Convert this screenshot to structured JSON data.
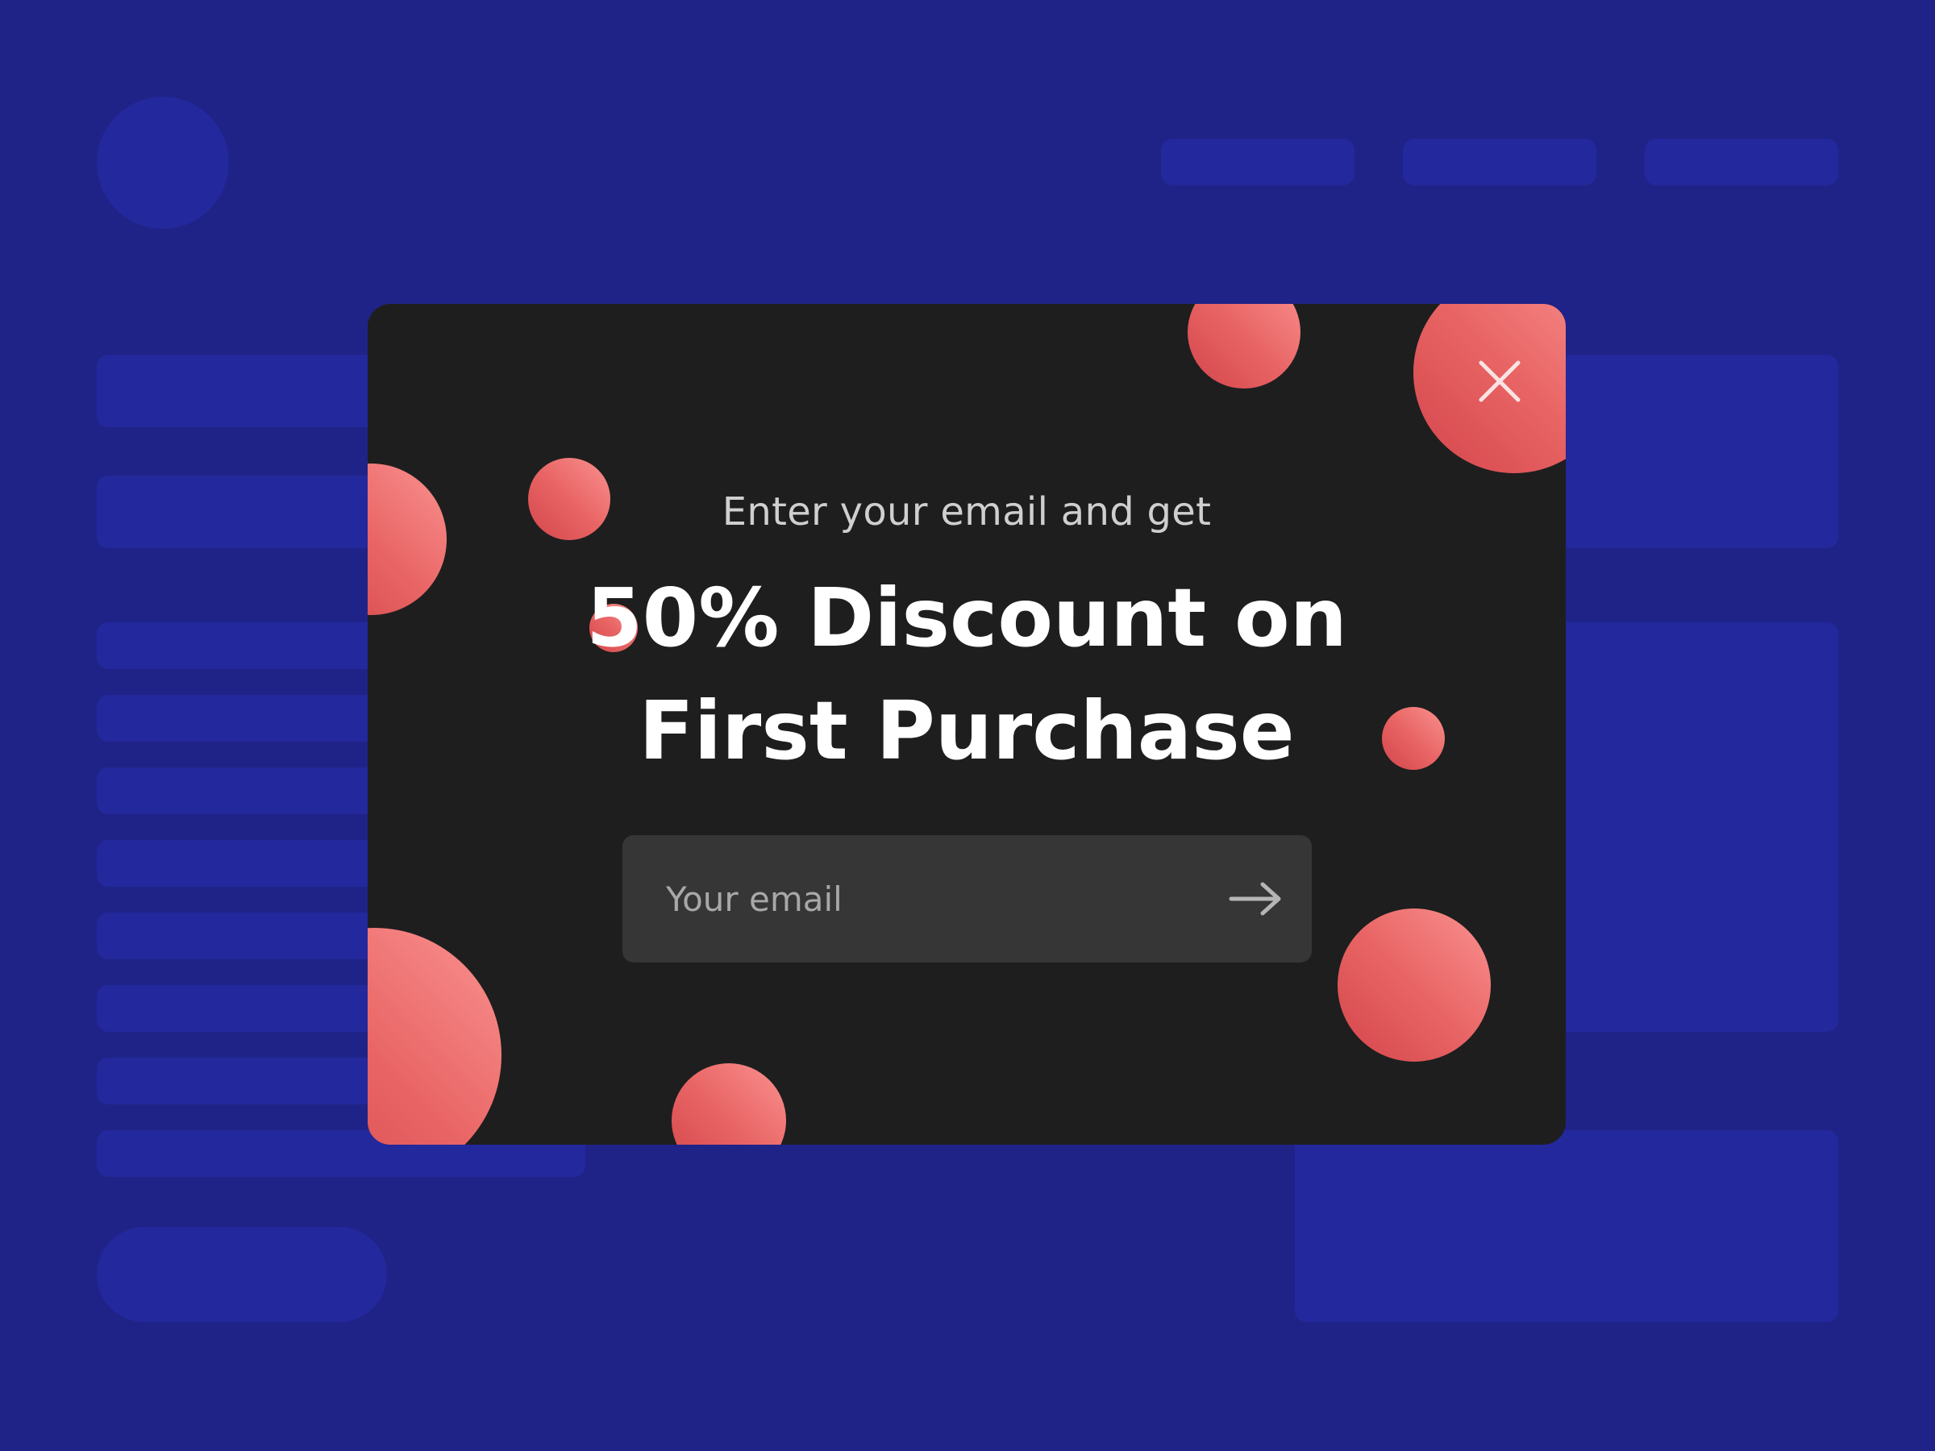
{
  "popup": {
    "subtitle": "Enter your email and get",
    "headline_line1": "50% Discount on",
    "headline_line2": "First Purchase",
    "email_placeholder": "Your email",
    "email_value": ""
  },
  "icons": {
    "close": "close-icon",
    "submit": "arrow-right-icon"
  },
  "colors": {
    "page_background": "#1f2387",
    "skeleton_block": "#23289c",
    "modal_background": "#1e1e1e",
    "input_background": "#363636",
    "bubble_accent": "#e96565",
    "headline_text": "#ffffff"
  }
}
